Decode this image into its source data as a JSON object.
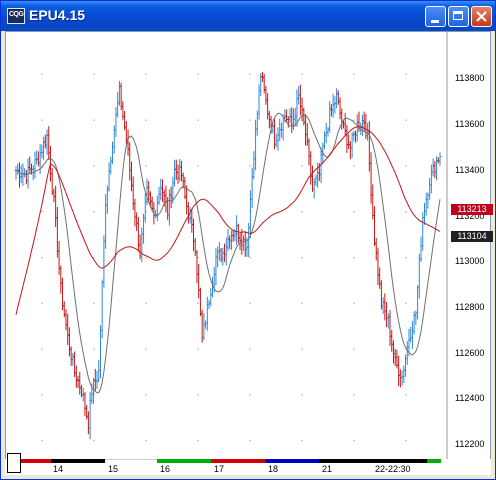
{
  "window": {
    "title": "EPU4.15",
    "icon_text": "CQG",
    "buttons": [
      "minimize",
      "maximize",
      "close"
    ]
  },
  "price_axis": {
    "labels": [
      "113800",
      "113600",
      "113400",
      "113200",
      "113000",
      "112800",
      "112600",
      "112400",
      "112200"
    ],
    "badges": [
      {
        "text": "113213",
        "color": "#c0001c"
      },
      {
        "text": "113104",
        "color": "#202020"
      }
    ]
  },
  "time_axis": {
    "labels": [
      "14",
      "15",
      "16",
      "17",
      "18",
      "21",
      "22-22:30"
    ],
    "session_colors": [
      "#d40000",
      "#000000",
      "#ffffff",
      "#00b000",
      "#d40000",
      "#0000c0",
      "#000000",
      "#00b000"
    ]
  },
  "chart_data": {
    "type": "bar",
    "symbol": "EPU4.15",
    "x": [
      "14",
      "15",
      "16",
      "17",
      "18",
      "21",
      "22-22:30"
    ],
    "ylim": [
      112150,
      113950
    ],
    "grid": true,
    "up_color": "#2f88d6",
    "down_color": "#c01818",
    "long_ma_color": "#c01818",
    "short_ma_color": "#707070",
    "last_price": 113213,
    "ma_value": 113104
  }
}
